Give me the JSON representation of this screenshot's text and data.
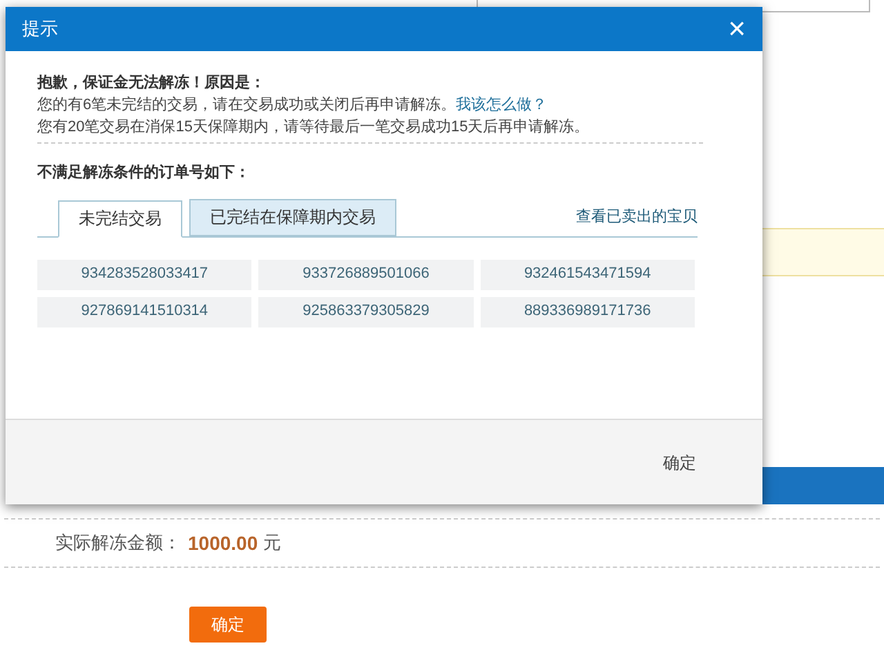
{
  "page": {
    "amount_label": "实际解冻金额：",
    "amount": "1000.00",
    "currency": "元",
    "confirm_button": "确定"
  },
  "dialog": {
    "title": "提示",
    "close": "×",
    "heading": "抱歉，保证金无法解冻！原因是：",
    "reason_1": "您的有6笔未完结的交易，请在交易成功或关闭后再申请解冻。",
    "help_link": "我该怎么做？",
    "reason_2": "您有20笔交易在消保15天保障期内，请等待最后一笔交易成功15天后再申请解冻。",
    "orders_heading": "不满足解冻条件的订单号如下：",
    "tabs": [
      {
        "label": "未完结交易",
        "selected": true
      },
      {
        "label": "已完结在保障期内交易",
        "selected": false
      }
    ],
    "sold_link": "查看已卖出的宝贝",
    "orders": [
      "934283528033417",
      "933726889501066",
      "932461543471594",
      "927869141510314",
      "925863379305829",
      "889336989171736"
    ],
    "footer_button": "确定"
  }
}
